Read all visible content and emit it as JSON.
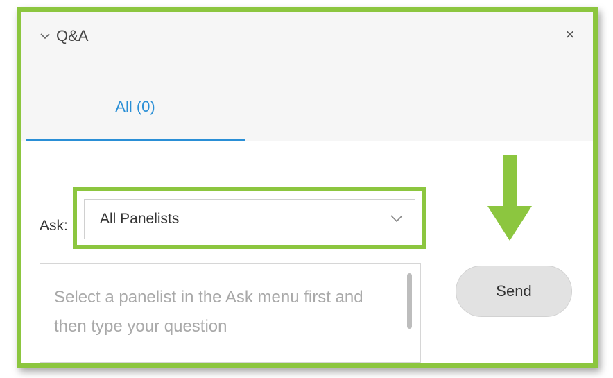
{
  "panel": {
    "title": "Q&A",
    "close_symbol": "×",
    "tab_label": "All (0)"
  },
  "ask": {
    "label": "Ask:",
    "selected": "All Panelists"
  },
  "question": {
    "placeholder": "Select a panelist in the Ask menu first and then type your question"
  },
  "send": {
    "label": "Send"
  },
  "icons": {
    "collapse": "chevron-down-icon",
    "close": "close-icon",
    "dropdown": "chevron-down-icon",
    "annotation_arrow": "arrow-down-icon"
  },
  "colors": {
    "highlight": "#8cc63f",
    "accent": "#2a8fd6"
  }
}
